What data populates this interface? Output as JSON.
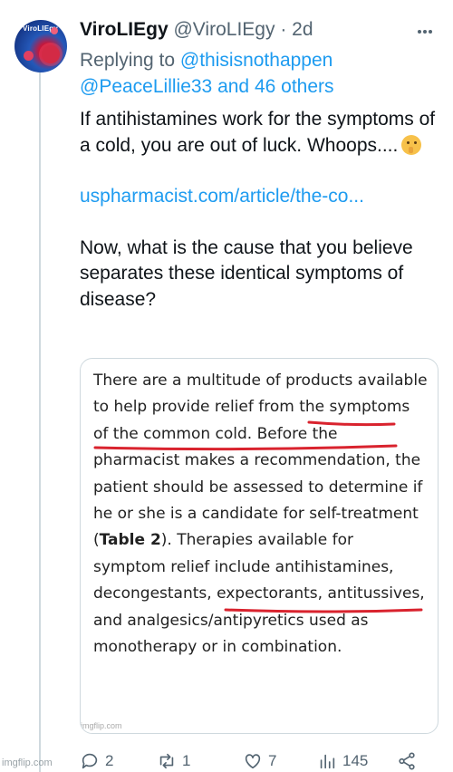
{
  "tweet": {
    "display_name": "ViroLIEgy",
    "handle": "@ViroLIEgy",
    "separator": "·",
    "time": "2d",
    "avatar_text": "ViroLIEgy",
    "replying_prefix": "Replying to",
    "replying_mention_1": "@thisisnothappen",
    "replying_mention_2": "@PeaceLillie33 and 46 others",
    "text_line_1": "If antihistamines work for the symptoms of a cold, you are out of luck. Whoops....",
    "link_text": "uspharmacist.com/article/the-co...",
    "text_line_2": "Now, what is the cause that you believe separates these identical symptoms of disease?",
    "image_text": {
      "part_1": "There are a multitude of products available to help provide relief from the symptoms of the common cold. Before the pharmacist makes a recommendation, the patient should be assessed to determine if he or she is a candidate for self-treatment (",
      "bold": "Table 2",
      "part_2": "). Therapies available for symptom relief include antihistamines, decongestants, expectorants, antitussives, and analgesics/antipyretics used as monotherapy or in combination.",
      "watermark": "imgflip.com",
      "underline_color": "#d9232e"
    },
    "actions": {
      "reply_count": "2",
      "retweet_count": "1",
      "like_count": "7",
      "views_count": "145"
    }
  },
  "watermark": "imgflip.com",
  "colors": {
    "link": "#1d9bf0",
    "secondary_text": "#536471",
    "primary_text": "#0f1419"
  }
}
